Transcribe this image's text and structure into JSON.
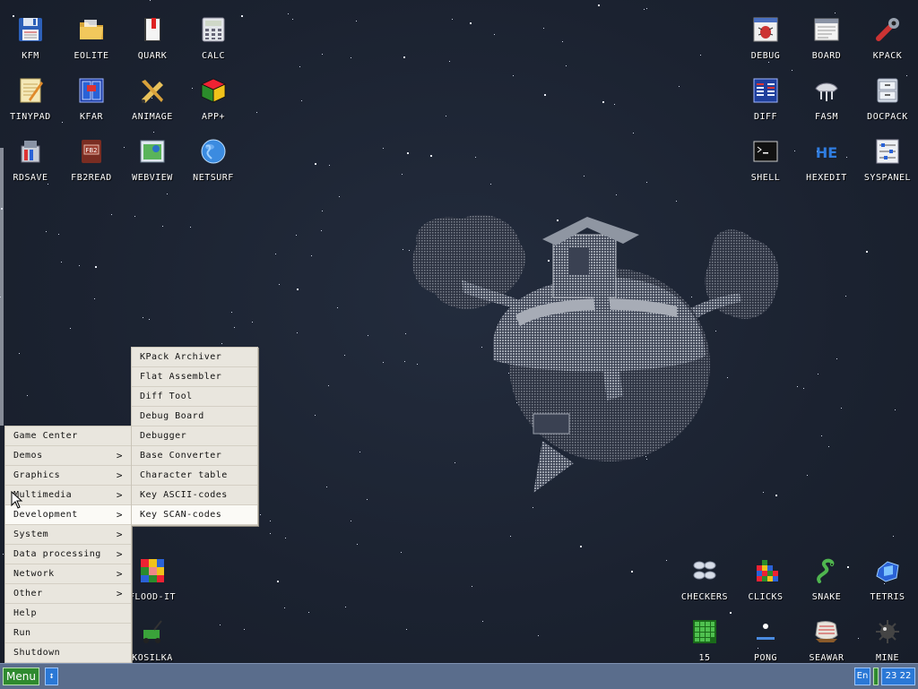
{
  "desktop": {
    "icons_left": [
      {
        "label": "KFM",
        "icon": "floppy-icon"
      },
      {
        "label": "EOLITE",
        "icon": "folder-icon"
      },
      {
        "label": "QUARK",
        "icon": "book-icon"
      },
      {
        "label": "CALC",
        "icon": "calculator-icon"
      },
      {
        "label": "TINYPAD",
        "icon": "notepad-icon"
      },
      {
        "label": "KFAR",
        "icon": "kfar-icon"
      },
      {
        "label": "ANIMAGE",
        "icon": "pencil-ruler-icon"
      },
      {
        "label": "APP+",
        "icon": "rubik-cube-icon"
      },
      {
        "label": "RDSAVE",
        "icon": "rdsave-icon"
      },
      {
        "label": "FB2READ",
        "icon": "fb2-book-icon"
      },
      {
        "label": "WEBVIEW",
        "icon": "webview-icon"
      },
      {
        "label": "NETSURF",
        "icon": "globe-icon"
      }
    ],
    "icons_right": [
      {
        "label": "DEBUG",
        "icon": "bug-icon"
      },
      {
        "label": "BOARD",
        "icon": "board-icon"
      },
      {
        "label": "KPACK",
        "icon": "wrench-icon"
      },
      {
        "label": "DIFF",
        "icon": "diff-icon"
      },
      {
        "label": "FASM",
        "icon": "fasm-icon"
      },
      {
        "label": "DOCPACK",
        "icon": "cabinet-icon"
      },
      {
        "label": "SHELL",
        "icon": "terminal-icon"
      },
      {
        "label": "HEXEDIT",
        "icon": "hex-icon"
      },
      {
        "label": "SYSPANEL",
        "icon": "sliders-icon"
      }
    ],
    "icons_games": [
      {
        "label": "CHECKERS",
        "icon": "checkers-icon"
      },
      {
        "label": "CLICKS",
        "icon": "clicks-icon"
      },
      {
        "label": "SNAKE",
        "icon": "snake-icon"
      },
      {
        "label": "TETRIS",
        "icon": "tetris-icon"
      },
      {
        "label": "15",
        "icon": "fifteen-icon"
      },
      {
        "label": "PONG",
        "icon": "pong-icon"
      },
      {
        "label": "SEAWAR",
        "icon": "seawar-icon"
      },
      {
        "label": "MINE",
        "icon": "mine-icon"
      }
    ],
    "icons_extra": [
      {
        "label": "FLOOD-IT",
        "icon": "flood-it-icon"
      },
      {
        "label": "KOSILKA",
        "icon": "lawnmower-icon"
      }
    ]
  },
  "main_menu": {
    "items": [
      {
        "label": "Game Center",
        "submenu": false
      },
      {
        "label": "Demos",
        "submenu": true
      },
      {
        "label": "Graphics",
        "submenu": true
      },
      {
        "label": "Multimedia",
        "submenu": true
      },
      {
        "label": "Development",
        "submenu": true
      },
      {
        "label": "System",
        "submenu": true
      },
      {
        "label": "Data processing",
        "submenu": true
      },
      {
        "label": "Network",
        "submenu": true
      },
      {
        "label": "Other",
        "submenu": true
      },
      {
        "label": "Help",
        "submenu": false
      },
      {
        "label": "Run",
        "submenu": false
      },
      {
        "label": "Shutdown",
        "submenu": false
      }
    ],
    "arrow": ">"
  },
  "dev_submenu": {
    "items": [
      {
        "label": "KPack Archiver"
      },
      {
        "label": "Flat Assembler"
      },
      {
        "label": "Diff Tool"
      },
      {
        "label": "Debug Board"
      },
      {
        "label": "Debugger"
      },
      {
        "label": "Base Converter"
      },
      {
        "label": "Character table"
      },
      {
        "label": "Key ASCII-codes"
      },
      {
        "label": "Key SCAN-codes"
      }
    ]
  },
  "taskbar": {
    "menu_label": "Menu",
    "switch_glyph": "↕",
    "lang": "En",
    "clock": "23 22"
  },
  "colors": {
    "desktop_bg": "#1b2230",
    "taskbar": "#5a6d8c",
    "menu_bg": "#e9e6de",
    "menu_button": "#2f8a2f",
    "tray_blue": "#2a78d6"
  }
}
